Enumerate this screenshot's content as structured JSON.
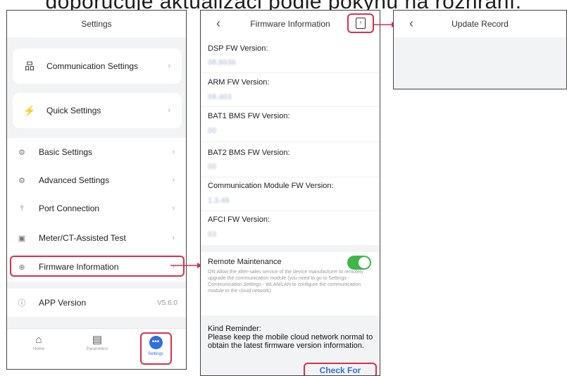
{
  "caption": "doporučuje aktualizaci podle pokynů na rozhraní.",
  "settings": {
    "title": "Settings",
    "cards": [
      {
        "icon": "network-icon",
        "glyph": "品",
        "label": "Communication Settings"
      },
      {
        "icon": "lightning-icon",
        "glyph": "⚡",
        "label": "Quick Settings"
      }
    ],
    "items": [
      {
        "icon": "gear-icon",
        "glyph": "⚙",
        "label": "Basic Settings"
      },
      {
        "icon": "advanced-gear-icon",
        "glyph": "⚙",
        "label": "Advanced Settings"
      },
      {
        "icon": "port-icon",
        "glyph": "⫯",
        "label": "Port Connection"
      },
      {
        "icon": "meter-icon",
        "glyph": "▣",
        "label": "Meter/CT-Assisted Test"
      },
      {
        "icon": "firmware-icon",
        "glyph": "⊕",
        "label": "Firmware Information"
      }
    ],
    "app_version": {
      "label": "APP Version",
      "value": "V5.6.0"
    },
    "tabs": [
      {
        "label": "Home",
        "icon": "home-icon"
      },
      {
        "label": "Parameters",
        "icon": "document-icon"
      },
      {
        "label": "Settings",
        "icon": "more-icon"
      }
    ]
  },
  "firmware": {
    "title": "Firmware Information",
    "entries": [
      {
        "label": "DSP FW Version:",
        "value": "08.8036"
      },
      {
        "label": "ARM FW Version:",
        "value": "09.403"
      },
      {
        "label": "BAT1 BMS FW Version:",
        "value": "00"
      },
      {
        "label": "BAT2 BMS FW Version:",
        "value": "00"
      },
      {
        "label": "Communication Module FW Version:",
        "value": "1.3.48"
      },
      {
        "label": "AFCI FW Version:",
        "value": "03"
      }
    ],
    "remote_maintenance": {
      "title": "Remote Maintenance",
      "description": "ON:Allow the after-sales service of the device manufacturer to remotely upgrade the communication module (you need to go to Settings - Communication Settings - WLAN/LAN to configure the communication module to the cloud network)",
      "enabled": true
    },
    "reminder": {
      "title": "Kind Reminder:",
      "text": "Please keep the mobile cloud network normal to obtain the latest firmware version information."
    },
    "check_button": "Check For Update"
  },
  "update_record": {
    "title": "Update Record"
  },
  "colors": {
    "accent": "#2f6ee0",
    "highlight": "#d6304f",
    "toggle_on": "#3fb649"
  }
}
